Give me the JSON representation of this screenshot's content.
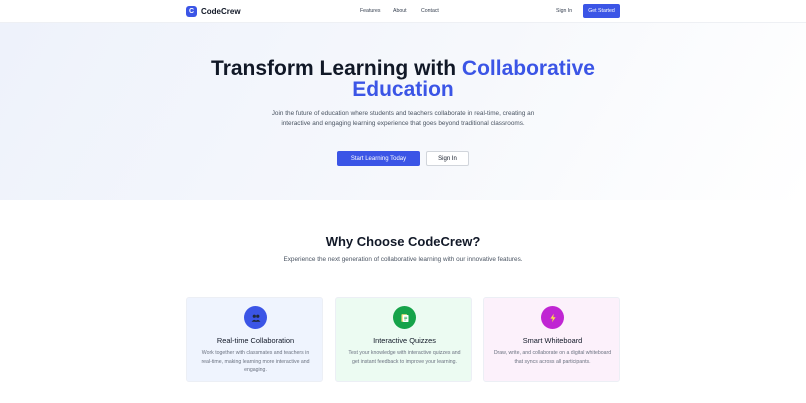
{
  "nav": {
    "logo_letter": "C",
    "brand": "CodeCrew",
    "links": [
      "Features",
      "About",
      "Contact"
    ],
    "signin": "Sign In",
    "get_started": "Get Started"
  },
  "hero": {
    "title_plain": "Transform Learning with ",
    "title_accent_1": "Collaborative",
    "title_accent_2": "Education",
    "subtitle": "Join the future of education where students and teachers collaborate in real-time, creating an interactive and engaging learning experience that goes beyond traditional classrooms.",
    "primary_button": "Start Learning Today",
    "secondary_button": "Sign In"
  },
  "features": {
    "title": "Why Choose CodeCrew?",
    "subtitle": "Experience the next generation of collaborative learning with our innovative features.",
    "cards": [
      {
        "icon": "users-icon",
        "title": "Real-time Collaboration",
        "description": "Work together with classmates and teachers in real-time, making learning more interactive and engaging."
      },
      {
        "icon": "quiz-icon",
        "title": "Interactive Quizzes",
        "description": "Test your knowledge with interactive quizzes and get instant feedback to improve your learning."
      },
      {
        "icon": "lightning-icon",
        "title": "Smart Whiteboard",
        "description": "Draw, write, and collaborate on a digital whiteboard that syncs across all participants."
      }
    ]
  },
  "colors": {
    "accent": "#3b55e6",
    "green": "#16a34a",
    "magenta": "#c026d3"
  }
}
